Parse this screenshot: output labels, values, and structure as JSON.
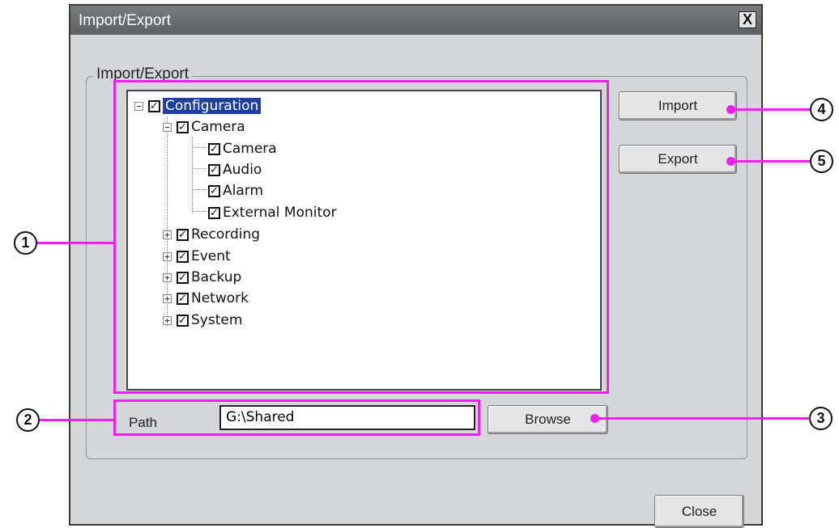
{
  "window": {
    "title": "Import/Export",
    "close_glyph": "X"
  },
  "group_label": "Import/Export",
  "tree": {
    "root": "Configuration",
    "camera": "Camera",
    "camera_children": [
      "Camera",
      "Audio",
      "Alarm",
      "External Monitor"
    ],
    "siblings": [
      "Recording",
      "Event",
      "Backup",
      "Network",
      "System"
    ]
  },
  "path": {
    "label": "Path",
    "value": "G:\\Shared"
  },
  "buttons": {
    "import": "Import",
    "export": "Export",
    "browse": "Browse",
    "close": "Close"
  },
  "callouts": [
    "1",
    "2",
    "3",
    "4",
    "5"
  ],
  "colors": {
    "highlight": "#f21df2",
    "selection": "#1f3f9c",
    "titlebar": "#6a6f73"
  }
}
